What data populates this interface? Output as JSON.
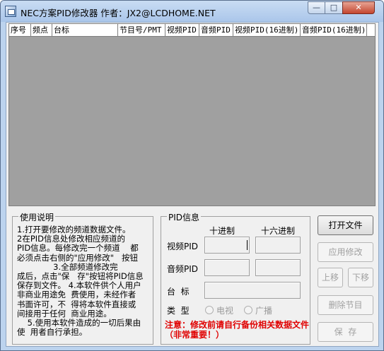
{
  "window": {
    "title": "NEC方案PID修改器 作者：JX2@LCDHOME.NET",
    "minimize_glyph": "—",
    "maximize_glyph": "□",
    "close_glyph": "✕"
  },
  "list": {
    "columns": [
      "序号",
      "频点",
      "台标",
      "节目号/PMT",
      "视频PID",
      "音频PID",
      "视频PID(16进制)",
      "音频PID(16进制)"
    ]
  },
  "usage": {
    "title": "使用说明",
    "lines": [
      "1.打开要修改的频道数据文件。",
      "2在PID信息处修改相应频道的",
      "PID信息。每修改完一个频道    都",
      "必须点击右侧的\"应用修改\"   按钮",
      "              3.全部频道修改完",
      "成后，点击\"保   存\"按钮将PID信息",
      "保存到文件。 4.本软件供个人用户",
      "非商业用途免  费使用，未经作者",
      "书面许可，不  得将本软件直接或",
      "间接用于任何  商业用途。",
      "    5.使用本软件造成的一切后果由",
      "使  用者自行承担。"
    ]
  },
  "pid": {
    "title": "PID信息",
    "decimal_header": "十进制",
    "hex_header": "十六进制",
    "video_label": "视频PID",
    "audio_label": "音频PID",
    "station_label": "台  标",
    "type_label": "类  型",
    "type_tv": "电视",
    "type_radio": "广播",
    "video_dec_value": "",
    "video_hex_value": "",
    "audio_dec_value": "",
    "audio_hex_value": "",
    "station_value": "",
    "note": "注意：修改前请自行备份相关数据文件（非常重要！）"
  },
  "buttons": {
    "open": "打开文件",
    "apply": "应用修改",
    "up": "上移",
    "down": "下移",
    "delete": "删除节目",
    "save": "保  存"
  }
}
